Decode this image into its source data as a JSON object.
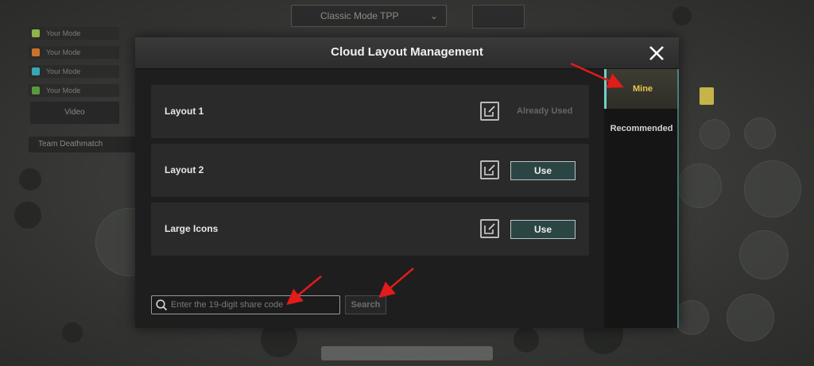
{
  "background": {
    "mode_selector_label": "Classic Mode TPP",
    "legend_items": [
      {
        "label": "Your Mode",
        "color": "#8fb34a"
      },
      {
        "label": "Your Mode",
        "color": "#c9722b"
      },
      {
        "label": "Your Mode",
        "color": "#3aa6b5"
      },
      {
        "label": "Your Mode",
        "color": "#5a9a3e"
      }
    ],
    "hud_button_label": "Video",
    "hud_banner_label": "Team Deathmatch"
  },
  "modal": {
    "title": "Cloud Layout Management",
    "layouts": [
      {
        "name": "Layout 1",
        "status": "Already Used"
      },
      {
        "name": "Layout 2",
        "action": "Use"
      },
      {
        "name": "Large Icons",
        "action": "Use"
      }
    ],
    "search": {
      "placeholder": "Enter the 19-digit share code",
      "button_label": "Search"
    },
    "tabs": [
      {
        "label": "Mine",
        "active": true
      },
      {
        "label": "Recommended",
        "active": false
      }
    ]
  },
  "colors": {
    "accent_gold": "#e8c94c",
    "use_button_bg": "#2b4544",
    "annotation_red": "#e21b1b"
  }
}
